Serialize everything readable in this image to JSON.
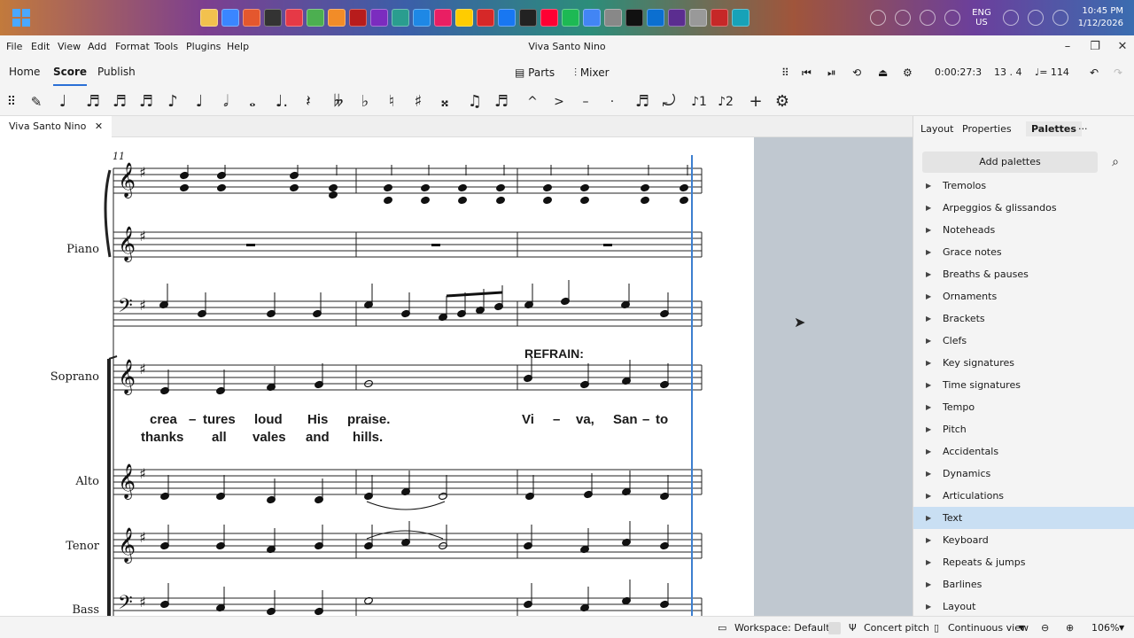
{
  "taskbar": {
    "lang": "ENG",
    "region": "US",
    "time": "10:45 PM",
    "date": "1/12/2026"
  },
  "menubar": {
    "items": [
      "File",
      "Edit",
      "View",
      "Add",
      "Format",
      "Tools",
      "Plugins",
      "Help"
    ],
    "window_title": "Viva Santo Nino"
  },
  "tabs": {
    "home": "Home",
    "score": "Score",
    "publish": "Publish",
    "parts": "Parts",
    "mixer": "Mixer"
  },
  "playback": {
    "time": "0:00:27:3",
    "position": "13 . 4",
    "tempo": "♩= 114"
  },
  "doc_tab": {
    "label": "Viva Santo Nino"
  },
  "panel": {
    "tabs": [
      "Layout",
      "Properties",
      "Palettes"
    ],
    "add_palettes": "Add palettes",
    "palettes": [
      "Tremolos",
      "Arpeggios & glissandos",
      "Noteheads",
      "Grace notes",
      "Breaths & pauses",
      "Ornaments",
      "Brackets",
      "Clefs",
      "Key signatures",
      "Time signatures",
      "Tempo",
      "Pitch",
      "Accidentals",
      "Dynamics",
      "Articulations",
      "Text",
      "Keyboard",
      "Repeats & jumps",
      "Barlines",
      "Layout"
    ],
    "selected": "Text"
  },
  "score": {
    "measure_number": "11",
    "staves": [
      "Piano",
      "Soprano",
      "Alto",
      "Tenor",
      "Bass"
    ],
    "rehearsal": "REFRAIN:",
    "lyrics_line1": [
      "crea",
      "–",
      "tures",
      "loud",
      "His",
      "praise.",
      "Vi",
      "–",
      "va,",
      "San",
      "–",
      "to"
    ],
    "lyrics_line2": [
      "thanks",
      "all",
      "vales",
      "and",
      "hills."
    ]
  },
  "status": {
    "workspace": "Workspace: Default",
    "concert_pitch": "Concert pitch",
    "view_mode": "Continuous view",
    "zoom": "106%"
  }
}
